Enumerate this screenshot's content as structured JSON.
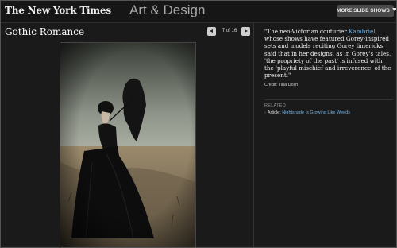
{
  "header": {
    "logo": "The New York Times",
    "section": "Art & Design",
    "more_button": "MORE SLIDE SHOWS"
  },
  "slideshow": {
    "title": "Gothic Romance",
    "counter": "7 of 16"
  },
  "caption": {
    "quote_before": "\"The neo-Victorian couturier ",
    "quote_link": "Kambriel",
    "quote_after": ", whose shows have featured Gorey-inspired sets and models reciting Gorey limericks, said that in her designs, as in Gorey's tales, 'the propriety of the past' is infused with the 'playful mischief and irreverence' of the present.\"",
    "credit": "Credit: Tina Dolin"
  },
  "related": {
    "label": "RELATED",
    "items": [
      {
        "prefix": "Article:",
        "title": "Nightshade Is Growing Like Weeds"
      }
    ]
  },
  "colors": {
    "link": "#6fb3e8",
    "background": "#1a1a1a"
  }
}
